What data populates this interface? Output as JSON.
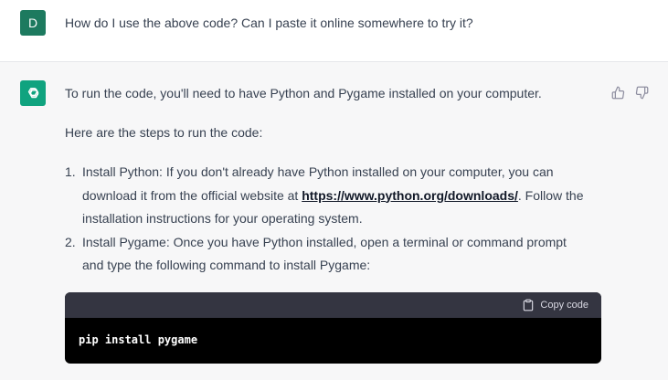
{
  "user_message": {
    "avatar_letter": "D",
    "text": "How do I use the above code? Can I paste it online somewhere to try it?"
  },
  "assistant_message": {
    "intro": "To run the code, you'll need to have Python and Pygame installed on your computer.",
    "steps_intro": "Here are the steps to run the code:",
    "steps": [
      {
        "number": "1.",
        "line1": "Install Python: If you don't already have Python installed on your computer, you can",
        "line2_before": "download it from the official website at ",
        "link": "https://www.python.org/downloads/",
        "line2_after": ". Follow the",
        "line3": "installation instructions for your operating system."
      },
      {
        "number": "2.",
        "line1": "Install Pygame: Once you have Python installed, open a terminal or command prompt",
        "line2": "and type the following command to install Pygame:"
      }
    ],
    "code_block": {
      "copy_label": "Copy code",
      "code": "pip install pygame"
    }
  },
  "colors": {
    "avatar_user": "#1d7a5f",
    "avatar_bot": "#10a37f",
    "code_header": "#343541",
    "code_body": "#000000"
  },
  "icons": [
    "openai-logo-icon",
    "thumbs-up-icon",
    "thumbs-down-icon",
    "clipboard-icon"
  ]
}
